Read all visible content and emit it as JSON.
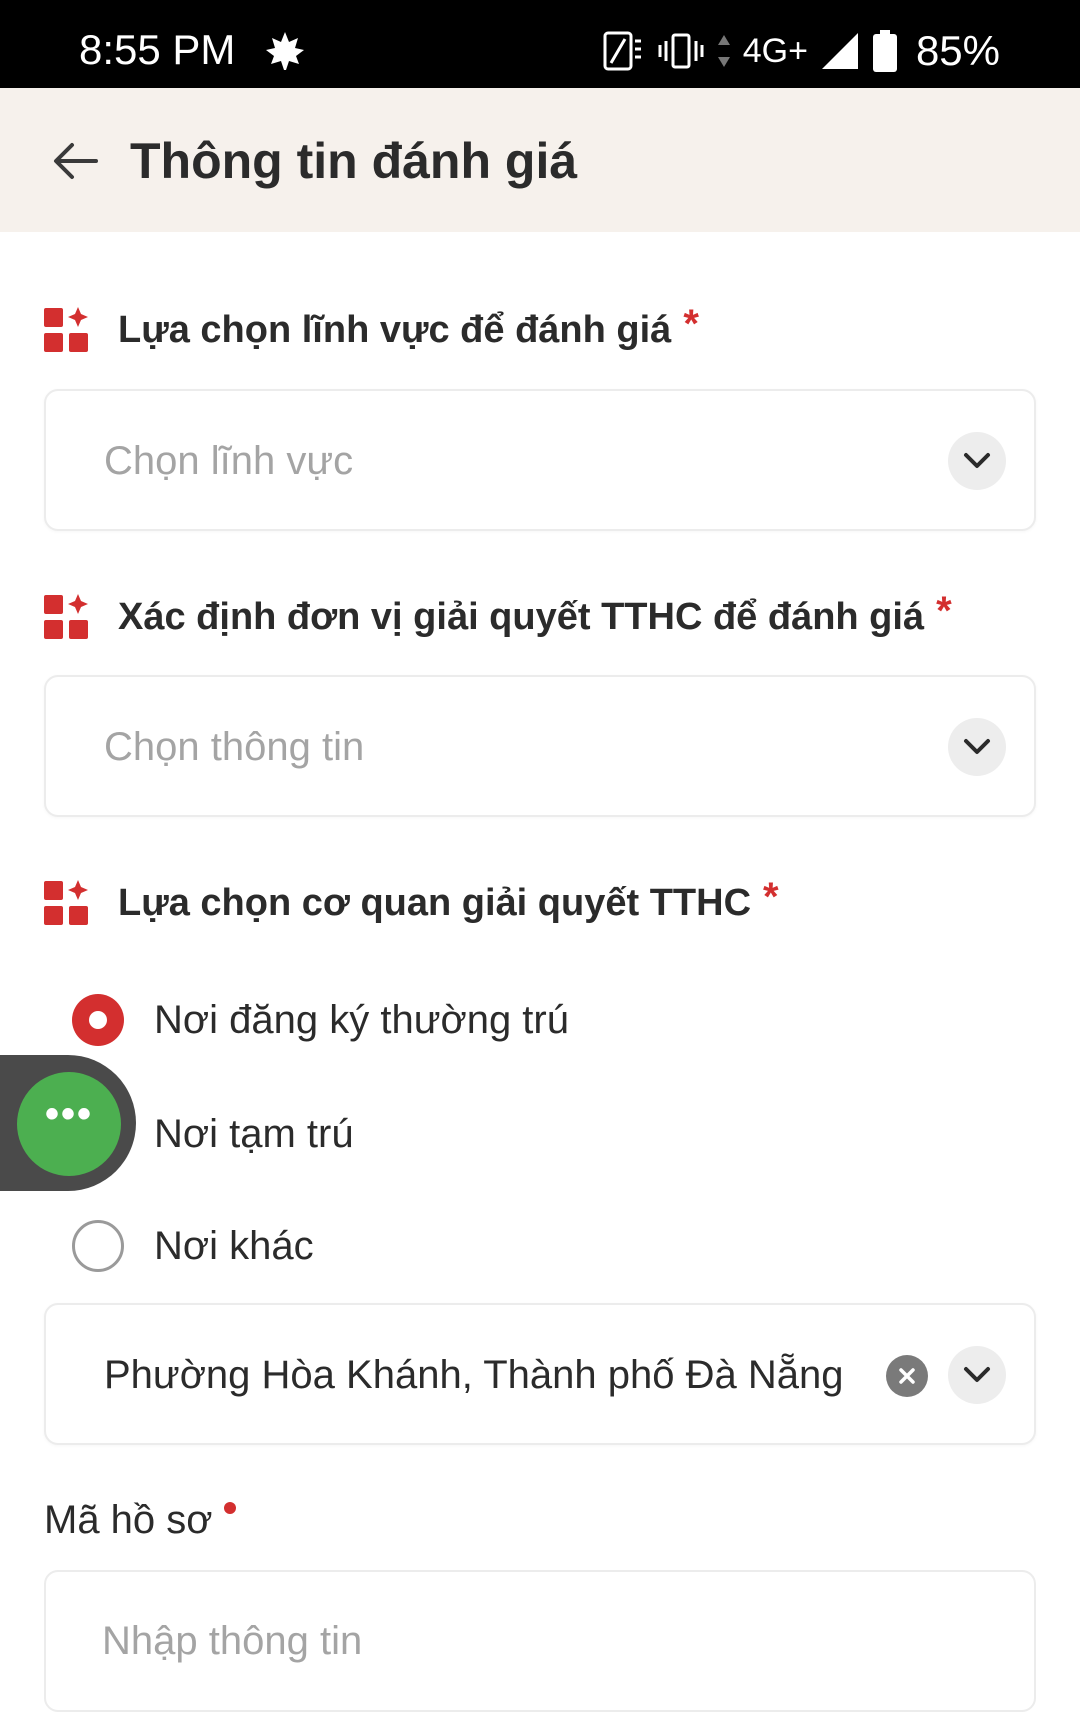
{
  "status_bar": {
    "time": "8:55 PM",
    "network": "4G+",
    "battery": "85%"
  },
  "header": {
    "title": "Thông tin đánh giá"
  },
  "section_field": {
    "label": "Lựa chọn lĩnh vực để đánh giá",
    "required_mark": "*",
    "placeholder": "Chọn lĩnh vực"
  },
  "section_unit": {
    "label": "Xác định đơn vị giải quyết TTHC để đánh giá",
    "required_mark": "*",
    "placeholder": "Chọn thông tin"
  },
  "section_agency": {
    "label": "Lựa chọn cơ quan giải quyết TTHC",
    "required_mark": "*",
    "options": [
      {
        "label": "Nơi đăng ký thường trú",
        "checked": true
      },
      {
        "label": "Nơi tạm trú",
        "checked": false
      },
      {
        "label": "Nơi khác",
        "checked": false
      }
    ],
    "selected_value": "Phường Hòa Khánh, Thành phố Đà Nẵng"
  },
  "record_code": {
    "label": "Mã hồ sơ",
    "placeholder": "Nhập thông tin"
  },
  "colors": {
    "accent_red": "#d32f2f",
    "header_bg": "#f6f1ec",
    "fab_green": "#4caf50"
  },
  "icons": {
    "back": "arrow-left-icon",
    "section": "grid-sparkle-icon",
    "chevron": "chevron-down-icon",
    "clear": "clear-x-icon",
    "fab": "more-dots-icon"
  }
}
